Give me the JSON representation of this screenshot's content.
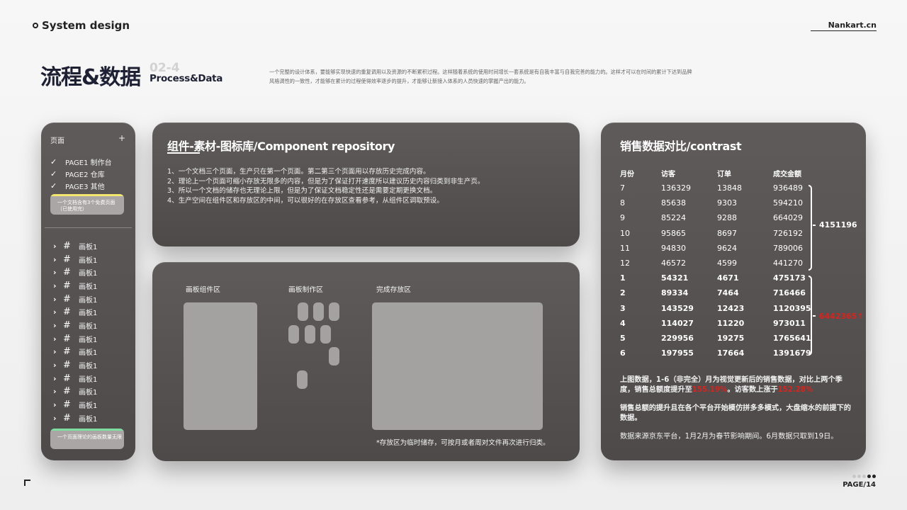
{
  "header": {
    "brand": "System design",
    "site": "Nankart.cn",
    "title_cn": "流程&数据",
    "title_num": "02-4",
    "title_en": "Process&Data",
    "intro": "一个完整的设计体系，要能够实现快速的重复调用以及资源的不断累积过程。这样随着系统的使用时间增长一套系统是有自我丰富与自我完善的能力的。这样才可以在时间的累计下达到品牌风格调性的一致性，才能够在累计的过程使得效率逐步的提升，才能够让新接入体系的人员快速的掌握产出的能力。"
  },
  "sidebar": {
    "heading": "页面",
    "add": "+",
    "pages": [
      "PAGE1 制作台",
      "PAGE2 仓库",
      "PAGE3 其他"
    ],
    "note1": "一个文档含有3个免费页面（已使用完）",
    "boards": [
      "画板1",
      "画板1",
      "画板1",
      "画板1",
      "画板1",
      "画板1",
      "画板1",
      "画板1",
      "画板1",
      "画板1",
      "画板1",
      "画板1",
      "画板1",
      "画板1"
    ],
    "note2": "一个页面理论的画板数量无限"
  },
  "component": {
    "title": "组件-素材-图标库/Component repository",
    "lines": [
      "1、一个文档三个页面，生产只在第一个页面。第二第三个页面用以存放历史完成内容。",
      "2、理论上一个页面可缩小存放无限多的内容，但是为了保证打开速度所以建议历史内容归类到非生产页。",
      "3、所以一个文档的储存也无理论上限，但是为了保证文档稳定性还是需要定期更换文档。",
      "4、生产空间在组件区和存放区的中间，可以很好的在存放区查看参考，从组件区调取预设。"
    ]
  },
  "work": {
    "zone1": "画板组件区",
    "zone2": "画板制作区",
    "zone3": "完成存放区",
    "footnote": "*存放区为临时储存，可按月或者周对文件再次进行归类。"
  },
  "sales": {
    "title": "销售数据对比/contrast",
    "columns": [
      "月份",
      "访客",
      "订单",
      "成交金额"
    ],
    "rows_prev": [
      [
        "7",
        "136329",
        "13848",
        "936489"
      ],
      [
        "8",
        "85638",
        "9303",
        "594210"
      ],
      [
        "9",
        "85224",
        "9288",
        "664029"
      ],
      [
        "10",
        "95865",
        "8697",
        "726192"
      ],
      [
        "11",
        "94830",
        "9624",
        "789006"
      ],
      [
        "12",
        "46572",
        "4599",
        "441270"
      ]
    ],
    "rows_new": [
      [
        "1",
        "54321",
        "4671",
        "475173"
      ],
      [
        "2",
        "89334",
        "7464",
        "716466"
      ],
      [
        "3",
        "143529",
        "12423",
        "1120395"
      ],
      [
        "4",
        "114027",
        "11220",
        "973011"
      ],
      [
        "5",
        "229956",
        "19275",
        "1765641"
      ],
      [
        "6",
        "197955",
        "17664",
        "1391679"
      ]
    ],
    "total_prev": "4151196",
    "total_new": "6442365↑",
    "para1_a": "上图数据，1-6（非完全）月为视觉更新后的销售数据，对比上两个季度，销售总额度提升至",
    "para1_pct1": "155.19%",
    "para1_b": "。访客数上涨于",
    "para1_pct2": "152.28%",
    "para2": "销售总额的提升且在各个平台开始模仿拼多多模式，大盘缩水的前提下的数据。",
    "para3": "数据来源京东平台，1月2月为春节影响期间。6月数据只取到19日。"
  },
  "footer": {
    "page": "PAGE/14",
    "dot_colors": [
      "#c8c8c8",
      "#c8c8c8",
      "#c8c8c8",
      "#222222",
      "#222222"
    ]
  }
}
